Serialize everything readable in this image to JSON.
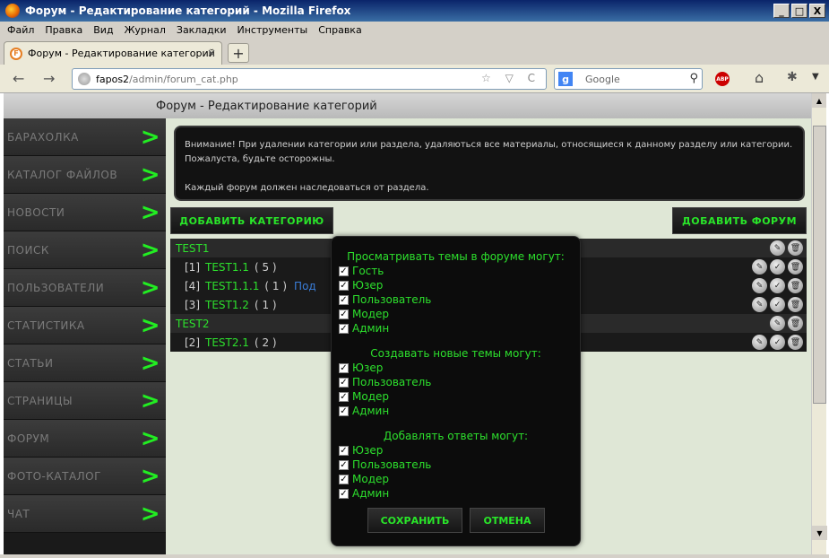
{
  "window": {
    "title": "Форум - Редактирование категорий - Mozilla Firefox",
    "buttons": [
      "_",
      "□",
      "X"
    ]
  },
  "menu": [
    "Файл",
    "Правка",
    "Вид",
    "Журнал",
    "Закладки",
    "Инструменты",
    "Справка"
  ],
  "tab": {
    "label": "Форум - Редактирование категорий",
    "close": "×",
    "new_tab": "+"
  },
  "nav": {
    "back": "←",
    "forward": "→",
    "url_host": "fapos2",
    "url_path": "/admin/forum_cat.php",
    "url_icons": "☆ ▽ C",
    "search_placeholder": "Google",
    "search_engine": "g",
    "abp": "ABP",
    "home": "⌂",
    "tool": "✱",
    "menu_arrow": "▼"
  },
  "page": {
    "header": "Форум - Редактирование категорий",
    "sidebar": [
      "БАРАХОЛКА",
      "КАТАЛОГ ФАЙЛОВ",
      "НОВОСТИ",
      "ПОИСК",
      "ПОЛЬЗОВАТЕЛИ",
      "СТАТИСТИКА",
      "СТАТЬИ",
      "СТРАНИЦЫ",
      "ФОРУМ",
      "ФОТО-КАТАЛОГ",
      "ЧАТ"
    ],
    "sidebar_chevron": ">",
    "notice": [
      "Внимание! При удалении категории или раздела, удаляються все материалы, относящиеся к данному разделу или категории. Пожалуста, будьте осторожны.",
      "Каждый форум должен наследоваться от раздела."
    ],
    "add_category": "ДОБАВИТЬ КАТЕГОРИЮ",
    "add_forum": "ДОБАВИТЬ ФОРУМ",
    "rows": [
      {
        "type": "cat",
        "name": "TEST1"
      },
      {
        "type": "forum",
        "index": "[1]",
        "name": "TEST1.1",
        "count": "( 5 )"
      },
      {
        "type": "forum",
        "index": "[4]",
        "name": "TEST1.1.1",
        "count": "( 1 )",
        "sub": "Под"
      },
      {
        "type": "forum",
        "index": "[3]",
        "name": "TEST1.2",
        "count": "( 1 )"
      },
      {
        "type": "cat",
        "name": "TEST2"
      },
      {
        "type": "forum",
        "index": "[2]",
        "name": "TEST2.1",
        "count": "( 2 )"
      }
    ]
  },
  "modal": {
    "view_header": "Просматривать темы в форуме могут:",
    "view_opts": [
      "Гость",
      "Юзер",
      "Пользователь",
      "Модер",
      "Админ"
    ],
    "create_header": "Создавать новые темы могут:",
    "create_opts": [
      "Юзер",
      "Пользователь",
      "Модер",
      "Админ"
    ],
    "reply_header": "Добавлять ответы могут:",
    "reply_opts": [
      "Юзер",
      "Пользователь",
      "Модер",
      "Админ"
    ],
    "check": "✓",
    "save": "СОХРАНИТЬ",
    "cancel": "ОТМЕНА"
  }
}
